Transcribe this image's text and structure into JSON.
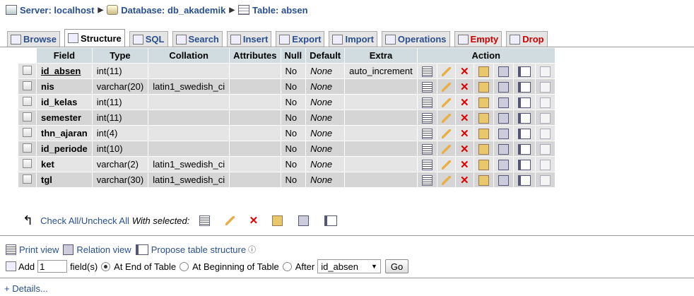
{
  "breadcrumb": {
    "server": "Server: localhost",
    "database": "Database: db_akademik",
    "table": "Table: absen"
  },
  "tabs": [
    {
      "label": "Browse",
      "icon": "browse-icon"
    },
    {
      "label": "Structure",
      "icon": "structure-icon"
    },
    {
      "label": "SQL",
      "icon": "sql-icon"
    },
    {
      "label": "Search",
      "icon": "search-icon"
    },
    {
      "label": "Insert",
      "icon": "insert-icon"
    },
    {
      "label": "Export",
      "icon": "export-icon"
    },
    {
      "label": "Import",
      "icon": "import-icon"
    },
    {
      "label": "Operations",
      "icon": "operations-icon"
    },
    {
      "label": "Empty",
      "icon": "empty-icon"
    },
    {
      "label": "Drop",
      "icon": "drop-icon"
    }
  ],
  "columns": {
    "field": "Field",
    "type": "Type",
    "collation": "Collation",
    "attributes": "Attributes",
    "null": "Null",
    "default": "Default",
    "extra": "Extra",
    "action": "Action"
  },
  "rows": [
    {
      "field": "id_absen",
      "type": "int(11)",
      "collation": "",
      "attributes": "",
      "null": "No",
      "default": "None",
      "extra": "auto_increment"
    },
    {
      "field": "nis",
      "type": "varchar(20)",
      "collation": "latin1_swedish_ci",
      "attributes": "",
      "null": "No",
      "default": "None",
      "extra": ""
    },
    {
      "field": "id_kelas",
      "type": "int(11)",
      "collation": "",
      "attributes": "",
      "null": "No",
      "default": "None",
      "extra": ""
    },
    {
      "field": "semester",
      "type": "int(11)",
      "collation": "",
      "attributes": "",
      "null": "No",
      "default": "None",
      "extra": ""
    },
    {
      "field": "thn_ajaran",
      "type": "int(4)",
      "collation": "",
      "attributes": "",
      "null": "No",
      "default": "None",
      "extra": ""
    },
    {
      "field": "id_periode",
      "type": "int(10)",
      "collation": "",
      "attributes": "",
      "null": "No",
      "default": "None",
      "extra": ""
    },
    {
      "field": "ket",
      "type": "varchar(2)",
      "collation": "latin1_swedish_ci",
      "attributes": "",
      "null": "No",
      "default": "None",
      "extra": ""
    },
    {
      "field": "tgl",
      "type": "varchar(30)",
      "collation": "latin1_swedish_ci",
      "attributes": "",
      "null": "No",
      "default": "None",
      "extra": ""
    }
  ],
  "bulk": {
    "check_all": "Check All",
    "slash": " / ",
    "uncheck_all": "Uncheck All",
    "with_selected": "With selected:"
  },
  "links": {
    "print_view": "Print view",
    "relation_view": "Relation view",
    "propose": "Propose table structure"
  },
  "add_field": {
    "add_label": "Add",
    "count": "1",
    "fields_label": "field(s)",
    "at_end": "At End of Table",
    "at_beginning": "At Beginning of Table",
    "after": "After",
    "after_value": "id_absen",
    "go": "Go"
  },
  "details": "+ Details..."
}
